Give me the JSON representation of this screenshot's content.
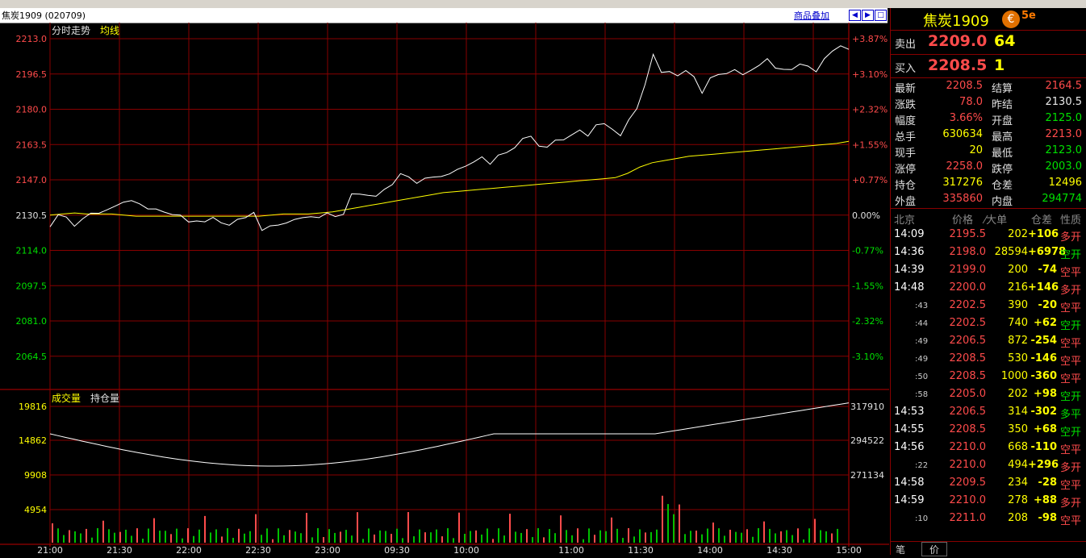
{
  "title": "焦炭1909 (020709)",
  "header_link": "商品叠加",
  "chart_title": "分时走势",
  "chart_avg_label": "均线",
  "vol_label": "成交量",
  "oi_label": "持仓量",
  "price_levels": [
    "2213.0",
    "2196.5",
    "2180.0",
    "2163.5",
    "2147.0",
    "2130.5",
    "2114.0",
    "2097.5",
    "2081.0",
    "2064.5"
  ],
  "pct_levels": [
    "+3.87%",
    "+3.10%",
    "+2.32%",
    "+1.55%",
    "+0.77%",
    "0.00%",
    "-0.77%",
    "-1.55%",
    "-2.32%",
    "-3.10%"
  ],
  "vol_levels": [
    "19816",
    "14862",
    "9908",
    "4954"
  ],
  "oi_levels": [
    "317910",
    "294522",
    "271134"
  ],
  "time_labels": [
    "21:00",
    "21:30",
    "22:00",
    "22:30",
    "23:00",
    "09:30",
    "10:00",
    "11:00",
    "11:30",
    "14:00",
    "14:30",
    "15:00"
  ],
  "chart_data": {
    "type": "line",
    "prev_settle": 2130.5,
    "ylim": [
      2064.5,
      2213.0
    ],
    "series": [
      {
        "name": "分时走势",
        "values": [
          2125,
          2131,
          2129,
          2126,
          2128,
          2132,
          2131,
          2133,
          2135,
          2136,
          2138,
          2135,
          2134,
          2133,
          2132,
          2131,
          2130,
          2128,
          2127,
          2128,
          2129,
          2127,
          2126,
          2128,
          2130,
          2131,
          2124,
          2125,
          2126,
          2127,
          2128,
          2130,
          2129,
          2130,
          2131,
          2130,
          2131,
          2140,
          2141,
          2139,
          2140,
          2142,
          2145,
          2150,
          2148,
          2146,
          2147,
          2149,
          2148,
          2150,
          2152,
          2153,
          2156,
          2157,
          2155,
          2158,
          2160,
          2162,
          2166,
          2168,
          2162,
          2163,
          2165,
          2166,
          2168,
          2170,
          2168,
          2172,
          2174,
          2170,
          2168,
          2175,
          2180,
          2192,
          2205,
          2198,
          2197,
          2196,
          2198,
          2195,
          2188,
          2194,
          2197,
          2196,
          2199,
          2196,
          2198,
          2201,
          2203,
          2200,
          2198,
          2199,
          2201,
          2200,
          2198,
          2203,
          2208,
          2209,
          2208.5
        ]
      },
      {
        "name": "均线",
        "values": [
          2130.5,
          2131,
          2131.5,
          2131,
          2131,
          2131,
          2130.5,
          2130,
          2130,
          2130,
          2130,
          2130,
          2130,
          2130,
          2130,
          2130,
          2130,
          2130,
          2130.5,
          2131,
          2131,
          2131,
          2131.5,
          2132,
          2133,
          2134,
          2135,
          2136,
          2137,
          2138,
          2139,
          2140,
          2141,
          2141.5,
          2142,
          2142.5,
          2143,
          2143.5,
          2144,
          2144.5,
          2145,
          2145.5,
          2146,
          2146.5,
          2147,
          2147.5,
          2148,
          2150,
          2153,
          2155,
          2156,
          2157,
          2158,
          2158.5,
          2159,
          2159.5,
          2160,
          2160.5,
          2161,
          2161.5,
          2162,
          2162.5,
          2163,
          2163.5,
          2164,
          2165
        ]
      }
    ]
  },
  "quote": {
    "name": "焦炭1909",
    "sell_label": "卖出",
    "sell_price": "2209.0",
    "sell_vol": "64",
    "buy_label": "买入",
    "buy_price": "2208.5",
    "buy_vol": "1",
    "rows": [
      {
        "l1": "最新",
        "v1": "2208.5",
        "c1": "red",
        "l2": "结算",
        "v2": "2164.5",
        "c2": "red"
      },
      {
        "l1": "涨跌",
        "v1": "78.0",
        "c1": "red",
        "l2": "昨结",
        "v2": "2130.5",
        "c2": "white"
      },
      {
        "l1": "幅度",
        "v1": "3.66%",
        "c1": "red",
        "l2": "开盘",
        "v2": "2125.0",
        "c2": "green"
      },
      {
        "l1": "总手",
        "v1": "630634",
        "c1": "yellow",
        "l2": "最高",
        "v2": "2213.0",
        "c2": "red"
      },
      {
        "l1": "现手",
        "v1": "20",
        "c1": "yellow",
        "l2": "最低",
        "v2": "2123.0",
        "c2": "green"
      },
      {
        "l1": "涨停",
        "v1": "2258.0",
        "c1": "red",
        "l2": "跌停",
        "v2": "2003.0",
        "c2": "green"
      },
      {
        "l1": "持仓",
        "v1": "317276",
        "c1": "yellow",
        "l2": "仓差",
        "v2": "12496",
        "c2": "yellow"
      },
      {
        "l1": "外盘",
        "v1": "335860",
        "c1": "red",
        "l2": "内盘",
        "v2": "294774",
        "c2": "green"
      }
    ]
  },
  "trades_header": {
    "time": "北京",
    "price": "价格",
    "vol": "⁄大单",
    "oi": "仓差",
    "type": "性质"
  },
  "trades": [
    {
      "t": "14:09",
      "p": "2195.5",
      "v": "202",
      "d": "+106",
      "k": "多开",
      "kc": "red"
    },
    {
      "t": "14:36",
      "p": "2198.0",
      "v": "28594",
      "d": "+6978",
      "k": "空开",
      "kc": "green"
    },
    {
      "t": "14:39",
      "p": "2199.0",
      "v": "200",
      "d": "-74",
      "k": "空平",
      "kc": "red"
    },
    {
      "t": "14:48",
      "p": "2200.0",
      "v": "216",
      "d": "+146",
      "k": "多开",
      "kc": "red"
    },
    {
      "t": ":43",
      "p": "2202.5",
      "v": "390",
      "d": "-20",
      "k": "空平",
      "kc": "red"
    },
    {
      "t": ":44",
      "p": "2202.5",
      "v": "740",
      "d": "+62",
      "k": "空开",
      "kc": "green"
    },
    {
      "t": ":49",
      "p": "2206.5",
      "v": "872",
      "d": "-254",
      "k": "空平",
      "kc": "red"
    },
    {
      "t": ":49",
      "p": "2208.5",
      "v": "530",
      "d": "-146",
      "k": "空平",
      "kc": "red"
    },
    {
      "t": ":50",
      "p": "2208.5",
      "v": "1000",
      "d": "-360",
      "k": "空平",
      "kc": "red"
    },
    {
      "t": ":58",
      "p": "2205.0",
      "v": "202",
      "d": "+98",
      "k": "空开",
      "kc": "green"
    },
    {
      "t": "14:53",
      "p": "2206.5",
      "v": "314",
      "d": "-302",
      "k": "多平",
      "kc": "green"
    },
    {
      "t": "14:55",
      "p": "2208.5",
      "v": "350",
      "d": "+68",
      "k": "空开",
      "kc": "green"
    },
    {
      "t": "14:56",
      "p": "2210.0",
      "v": "668",
      "d": "-110",
      "k": "空平",
      "kc": "red"
    },
    {
      "t": ":22",
      "p": "2210.0",
      "v": "494",
      "d": "+296",
      "k": "多开",
      "kc": "red"
    },
    {
      "t": "14:58",
      "p": "2209.5",
      "v": "234",
      "d": "-28",
      "k": "空平",
      "kc": "red"
    },
    {
      "t": "14:59",
      "p": "2210.0",
      "v": "278",
      "d": "+88",
      "k": "多开",
      "kc": "red"
    },
    {
      "t": ":10",
      "p": "2211.0",
      "v": "208",
      "d": "-98",
      "k": "空平",
      "kc": "red"
    }
  ],
  "bottom_tabs": [
    "笔",
    "价"
  ]
}
